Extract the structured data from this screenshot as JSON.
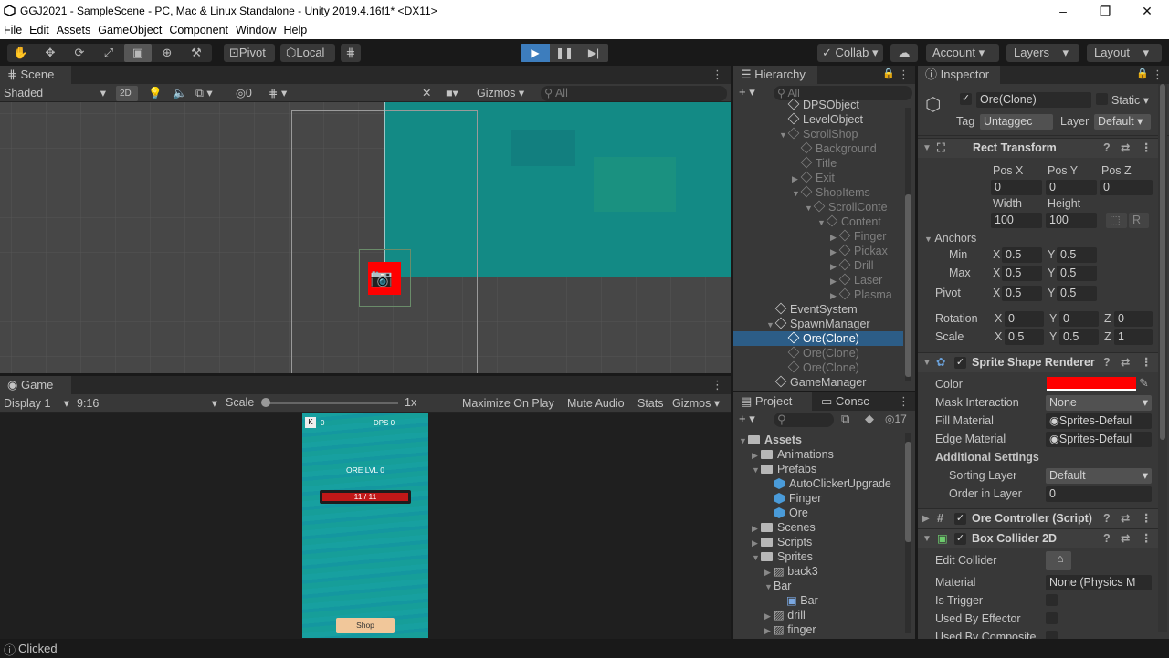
{
  "window": {
    "title": "GGJ2021 - SampleScene - PC, Mac & Linux Standalone - Unity 2019.4.16f1* <DX11>"
  },
  "menu": [
    "File",
    "Edit",
    "Assets",
    "GameObject",
    "Component",
    "Window",
    "Help"
  ],
  "toolbar": {
    "pivot": "Pivot",
    "local": "Local",
    "collab": "Collab",
    "account": "Account",
    "layers": "Layers",
    "layout": "Layout"
  },
  "scene": {
    "tab": "Scene",
    "shading": "Shaded",
    "mode2d": "2D",
    "hidden_count": "0",
    "gizmos": "Gizmos",
    "search_placeholder": "All"
  },
  "game": {
    "tab": "Game",
    "display": "Display 1",
    "aspect": "9:16",
    "scale_label": "Scale",
    "scale_value": "1x",
    "maximize": "Maximize On Play",
    "mute": "Mute Audio",
    "stats": "Stats",
    "gizmos": "Gizmos",
    "hud": {
      "coins": "0",
      "dps": "DPS  0",
      "ore_level": "ORE LVL 0",
      "health": "11 / 11",
      "health_fraction": 1.0,
      "shop": "Shop"
    }
  },
  "hierarchy": {
    "tab": "Hierarchy",
    "search_placeholder": "All",
    "items": [
      {
        "label": "DPSObject",
        "depth": 1,
        "arrow": "",
        "dim": false
      },
      {
        "label": "LevelObject",
        "depth": 1,
        "arrow": "",
        "dim": false
      },
      {
        "label": "ScrollShop",
        "depth": 1,
        "arrow": "▼",
        "dim": true
      },
      {
        "label": "Background",
        "depth": 2,
        "arrow": "",
        "dim": true
      },
      {
        "label": "Title",
        "depth": 2,
        "arrow": "",
        "dim": true
      },
      {
        "label": "Exit",
        "depth": 2,
        "arrow": "▶",
        "dim": true
      },
      {
        "label": "ShopItems",
        "depth": 2,
        "arrow": "▼",
        "dim": true
      },
      {
        "label": "ScrollConte",
        "depth": 3,
        "arrow": "▼",
        "dim": true
      },
      {
        "label": "Content",
        "depth": 4,
        "arrow": "▼",
        "dim": true
      },
      {
        "label": "Finger",
        "depth": 5,
        "arrow": "▶",
        "dim": true
      },
      {
        "label": "Pickax",
        "depth": 5,
        "arrow": "▶",
        "dim": true
      },
      {
        "label": "Drill",
        "depth": 5,
        "arrow": "▶",
        "dim": true
      },
      {
        "label": "Laser",
        "depth": 5,
        "arrow": "▶",
        "dim": true
      },
      {
        "label": "Plasma",
        "depth": 5,
        "arrow": "▶",
        "dim": true
      },
      {
        "label": "EventSystem",
        "depth": 0,
        "arrow": "",
        "dim": false
      },
      {
        "label": "SpawnManager",
        "depth": 0,
        "arrow": "▼",
        "dim": false
      },
      {
        "label": "Ore(Clone)",
        "depth": 1,
        "arrow": "",
        "dim": false,
        "selected": true
      },
      {
        "label": "Ore(Clone)",
        "depth": 1,
        "arrow": "",
        "dim": true
      },
      {
        "label": "Ore(Clone)",
        "depth": 1,
        "arrow": "",
        "dim": true
      },
      {
        "label": "GameManager",
        "depth": 0,
        "arrow": "",
        "dim": false
      }
    ]
  },
  "project": {
    "tab": "Project",
    "console_tab": "Consc",
    "hidden_count": "17",
    "items": [
      {
        "label": "Assets",
        "depth": 0,
        "arrow": "▼",
        "kind": "folder",
        "bold": true
      },
      {
        "label": "Animations",
        "depth": 1,
        "arrow": "▶",
        "kind": "folder"
      },
      {
        "label": "Prefabs",
        "depth": 1,
        "arrow": "▼",
        "kind": "folder"
      },
      {
        "label": "AutoClickerUpgrade",
        "depth": 2,
        "arrow": "",
        "kind": "prefab"
      },
      {
        "label": "Finger",
        "depth": 2,
        "arrow": "",
        "kind": "prefab"
      },
      {
        "label": "Ore",
        "depth": 2,
        "arrow": "",
        "kind": "prefab"
      },
      {
        "label": "Scenes",
        "depth": 1,
        "arrow": "▶",
        "kind": "folder"
      },
      {
        "label": "Scripts",
        "depth": 1,
        "arrow": "▶",
        "kind": "folder"
      },
      {
        "label": "Sprites",
        "depth": 1,
        "arrow": "▼",
        "kind": "folder"
      },
      {
        "label": "back3",
        "depth": 2,
        "arrow": "▶",
        "kind": "image"
      },
      {
        "label": "Bar",
        "depth": 2,
        "arrow": "▼",
        "kind": "none"
      },
      {
        "label": "Bar",
        "depth": 3,
        "arrow": "",
        "kind": "sprite"
      },
      {
        "label": "drill",
        "depth": 2,
        "arrow": "▶",
        "kind": "image"
      },
      {
        "label": "finger",
        "depth": 2,
        "arrow": "▶",
        "kind": "image"
      }
    ]
  },
  "inspector": {
    "tab": "Inspector",
    "object_name": "Ore(Clone)",
    "static": "Static",
    "tag_label": "Tag",
    "tag": "Untaggec",
    "layer_label": "Layer",
    "layer": "Default",
    "rect": {
      "title": "Rect Transform",
      "posx_l": "Pos X",
      "posy_l": "Pos Y",
      "posz_l": "Pos Z",
      "posx": "0",
      "posy": "0",
      "posz": "0",
      "width_l": "Width",
      "height_l": "Height",
      "width": "100",
      "height": "100",
      "r": "R",
      "anchors": "Anchors",
      "min": "Min",
      "max": "Max",
      "pivot": "Pivot",
      "x": "X",
      "y": "Y",
      "z": "Z",
      "min_x": "0.5",
      "min_y": "0.5",
      "max_x": "0.5",
      "max_y": "0.5",
      "pivot_x": "0.5",
      "pivot_y": "0.5",
      "rotation": "Rotation",
      "rot_x": "0",
      "rot_y": "0",
      "rot_z": "0",
      "scale": "Scale",
      "scale_x": "0.5",
      "scale_y": "0.5",
      "scale_z": "1"
    },
    "sprite": {
      "title": "Sprite Shape Renderer",
      "color_l": "Color",
      "color": "#ff0000",
      "mask_l": "Mask Interaction",
      "mask": "None",
      "fill_l": "Fill Material",
      "fill": "Sprites-Defaul",
      "edge_l": "Edge Material",
      "edge": "Sprites-Defaul",
      "additional": "Additional Settings",
      "sorting_l": "Sorting Layer",
      "sorting": "Default",
      "order_l": "Order in Layer",
      "order": "0"
    },
    "ore_controller": "Ore Controller (Script)",
    "box": {
      "title": "Box Collider 2D",
      "edit_l": "Edit Collider",
      "material_l": "Material",
      "material": "None (Physics M",
      "trigger_l": "Is Trigger",
      "effector_l": "Used By Effector",
      "composite_l": "Used By Composite"
    }
  },
  "status": {
    "text": "Clicked"
  },
  "colors": {
    "selection": "#2c5d87",
    "teal": "#159b9b",
    "sprite_red": "#ff0000"
  }
}
